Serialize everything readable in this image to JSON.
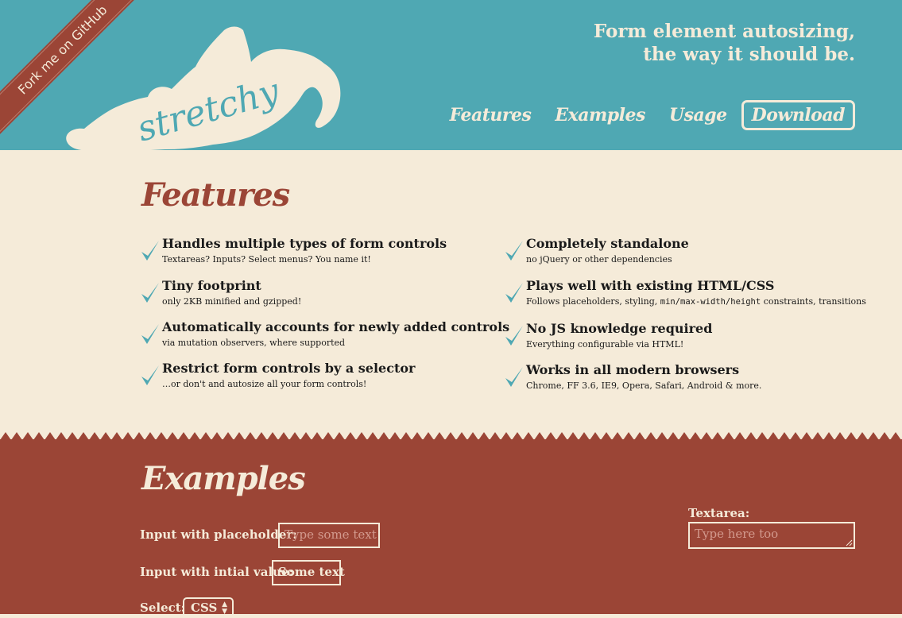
{
  "header": {
    "ribbon_text": "Fork me on GitHub",
    "logo_text": "stretchy",
    "tagline_line1": "Form element autosizing,",
    "tagline_line2": "the way it should be.",
    "nav": {
      "features": "Features",
      "examples": "Examples",
      "usage": "Usage",
      "download": "Download"
    }
  },
  "colors": {
    "teal": "#4fa8b3",
    "cream": "#f5ebd9",
    "brick": "#9b4536"
  },
  "features": {
    "title": "Features",
    "items": [
      {
        "title": "Handles multiple types of form controls",
        "desc": "Textareas? Inputs? Select menus? You name it!"
      },
      {
        "title": "Tiny footprint",
        "desc": "only 2KB minified and gzipped!"
      },
      {
        "title": "Automatically accounts for newly added controls",
        "desc": "via mutation observers, where supported"
      },
      {
        "title": "Restrict form controls by a selector",
        "desc": "…or don't and autosize all your form controls!"
      },
      {
        "title": "Completely standalone",
        "desc": "no jQuery or other dependencies"
      },
      {
        "title": "Plays well with existing HTML/CSS",
        "desc_pre": "Follows placeholders, styling, ",
        "desc_code": "min/max-width/height",
        "desc_post": " constraints, transitions"
      },
      {
        "title": "No JS knowledge required",
        "desc": "Everything configurable via HTML!"
      },
      {
        "title": "Works in all modern browsers",
        "desc": "Chrome, FF 3.6, IE9, Opera, Safari, Android & more."
      }
    ]
  },
  "examples": {
    "title": "Examples",
    "placeholder_label": "Input with placeholder:",
    "placeholder_text": "Type some text",
    "initial_label": "Input with intial value:",
    "initial_value": "Some text",
    "select_label": "Select:",
    "select_value": "CSS",
    "textarea_label": "Textarea:",
    "textarea_placeholder": "Type here too"
  }
}
